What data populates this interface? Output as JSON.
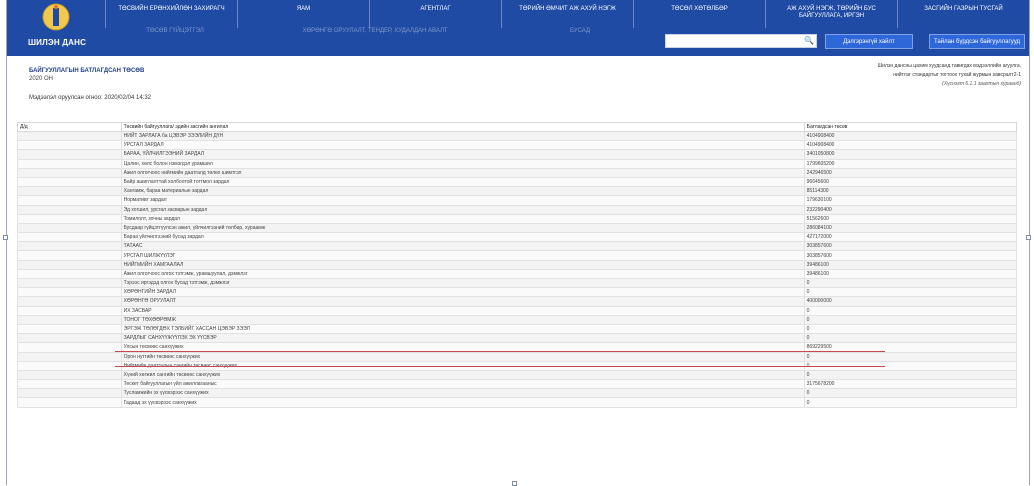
{
  "logo_text": "ШИЛЭН ДАНС",
  "nav": [
    "ТӨСВИЙН ЕРӨНХИЙЛӨН ЗАХИРАГЧ",
    "ЯАМ",
    "АГЕНТЛАГ",
    "ТӨРИЙН ӨМЧИТ АЖ АХУЙ НЭГЖ",
    "ТӨСӨЛ ХӨТӨЛБӨР",
    "АЖ АХУЙ НЭГЖ, ТӨРИЙН БУС БАЙГУУЛЛАГА, ИРГЭН",
    "ЗАСГИЙН ГАЗРЫН ТУСГАЙ"
  ],
  "subnav": [
    "ТӨСӨВ ГҮЙЦЭТГЭЛ",
    "ХӨРӨНГӨ ОРУУЛАЛТ, ТЕНДЕР, ХУДАЛДАН АВАЛТ",
    "БУСАД"
  ],
  "search": {
    "placeholder": ""
  },
  "buttons": {
    "find_org": "Дэлгэрэнгүй хайлт",
    "report_orgs": "Тайлан бүрдсэн байгууллагууд"
  },
  "doc": {
    "title": "БАЙГУУЛЛАГЫН БАТЛАГДСАН ТӨСӨВ",
    "year": "2020 ОН",
    "updated": "Мэдээлэл оруулсан огноо: 2020/02/04 14:32",
    "note1": "Шилэн дансны цахим хуудсанд тавигдах мэдээллийн агуулга,",
    "note2": "нийтлэг стандартыг тогтоох тухай журмын хавсралт2-1",
    "note3": "(Хүснэгт 6.1.1 заалтын хураанд)"
  },
  "table": {
    "headers": [
      "Д/д",
      "Төсвийн байгууллага/ эдийн засгийн ангилал",
      "Батлагдсан төсөв"
    ],
    "rows": [
      [
        "",
        "НИЙТ ЗАРЛАГА ба ЦЭВЭР ЗЭЭЛИЙН ДҮН",
        "4104908400"
      ],
      [
        "",
        "УРСГАЛ ЗАРДАЛ",
        "4104908400"
      ],
      [
        "",
        "БАРАА, ҮЙЛЧИЛГЭЭНИЙ ЗАРДАЛ",
        "3401050800"
      ],
      [
        "",
        "Цалин, хөлс болон нэмэгдэл урамшил",
        "1799605200"
      ],
      [
        "",
        "Ажил олгогчоос нийгмийн даатгалд төлөх шимтгэл",
        "242946500"
      ],
      [
        "",
        "Байр ашиглалттай холбоотой тогтмол зардал",
        "96645600"
      ],
      [
        "",
        "Хангамж, бараа материалын зардал",
        "85114300"
      ],
      [
        "",
        "Нормативт зардал",
        "179630100"
      ],
      [
        "",
        "Эд хогшил, урсгал засварын зардал",
        "232290400"
      ],
      [
        "",
        "Томилолт, зочны зардал",
        "51562600"
      ],
      [
        "",
        "Бусдаар гүйцэтгүүлсэн ажил, үйлчилгээний төлбөр, хураамж",
        "286084100"
      ],
      [
        "",
        "Бараа үйлчилгээний бусад зардал",
        "427172000"
      ],
      [
        "",
        "ТАТААС",
        "303857600"
      ],
      [
        "",
        "УРСГАЛ ШИЛЖҮҮЛЭГ",
        "303857600"
      ],
      [
        "",
        "НИЙГМИЙН ХАМГААЛАЛ",
        "39486100"
      ],
      [
        "",
        "Ажил олгогчоос олгох тэтгэмж, урамшуулал, дэмжлэг",
        "39486100"
      ],
      [
        "",
        "Тэрээс иргэдэд олгох бусад тэтгэмж, дэмжлэг",
        "0"
      ],
      [
        "",
        "ХӨРӨНГИЙН ЗАРДАЛ",
        "0"
      ],
      [
        "",
        "ХӨРӨНГӨ ОРУУЛАЛТ",
        "400000000"
      ],
      [
        "",
        "ИХ ЗАСВАР",
        "0"
      ],
      [
        "",
        "ТОНОГ ТӨХӨӨРӨМЖ",
        "0"
      ],
      [
        "",
        "ЭРГЭЖ ТӨЛӨГДӨХ ТЭЛБИЙГ ХАССАН ЦЭВЭР ЗЭЭЛ",
        "0"
      ],
      [
        "",
        "ЗАРДЛЫГ САНХҮҮЖҮҮЛЭХ ЭХ ҮҮСВЭР",
        "0"
      ],
      [
        "",
        "Улсын төсвөөс санхүүжих",
        "869229500"
      ],
      [
        "",
        "Орон нутгийн төсвөөс санхүүжих",
        "0"
      ],
      [
        "",
        "Нийгмийн даатгалын сангийн төсвөөс санхүүжих",
        "0"
      ],
      [
        "",
        "Хүний хөгжил сангийн төсвөөс санхүүжих",
        "0"
      ],
      [
        "",
        "Тескет байгууллагын үйл ажиллагааныс",
        "3175678200"
      ],
      [
        "",
        "Тусламжийн эх үүсвэрээс санхүүжих",
        "0"
      ],
      [
        "",
        "Гадаад эх үүсвэрээс санхүүжих",
        "0"
      ]
    ]
  },
  "colors": {
    "header_bg": "#1f4ba5",
    "button_bg": "#2d67d8",
    "highlight_line": "#c9474f"
  }
}
